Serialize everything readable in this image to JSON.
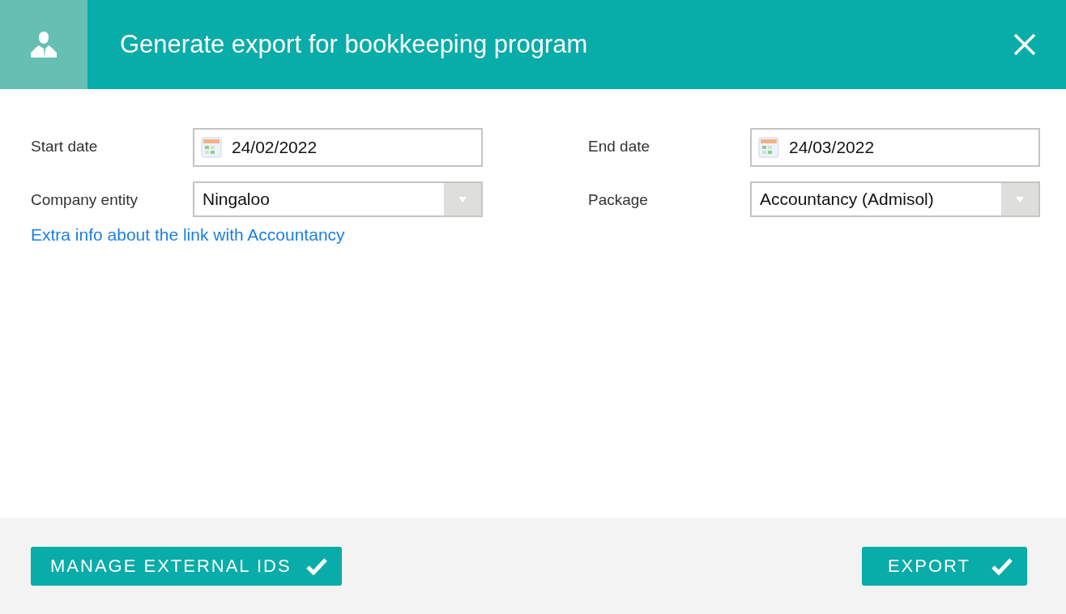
{
  "dialog": {
    "title": "Generate export for bookkeeping program"
  },
  "fields": [
    {
      "label": "Start date",
      "kind": "date",
      "value": "24/02/2022"
    },
    {
      "label": "End date",
      "kind": "date",
      "value": "24/03/2022"
    },
    {
      "label": "Company entity",
      "kind": "select",
      "value": "Ningaloo"
    },
    {
      "label": "Package",
      "kind": "select",
      "value": "Accountancy (Admisol)"
    }
  ],
  "link": "Extra info about the link with Accountancy",
  "buttons": [
    {
      "label": "MANAGE EXTERNAL IDS"
    },
    {
      "label": "EXPORT"
    }
  ]
}
